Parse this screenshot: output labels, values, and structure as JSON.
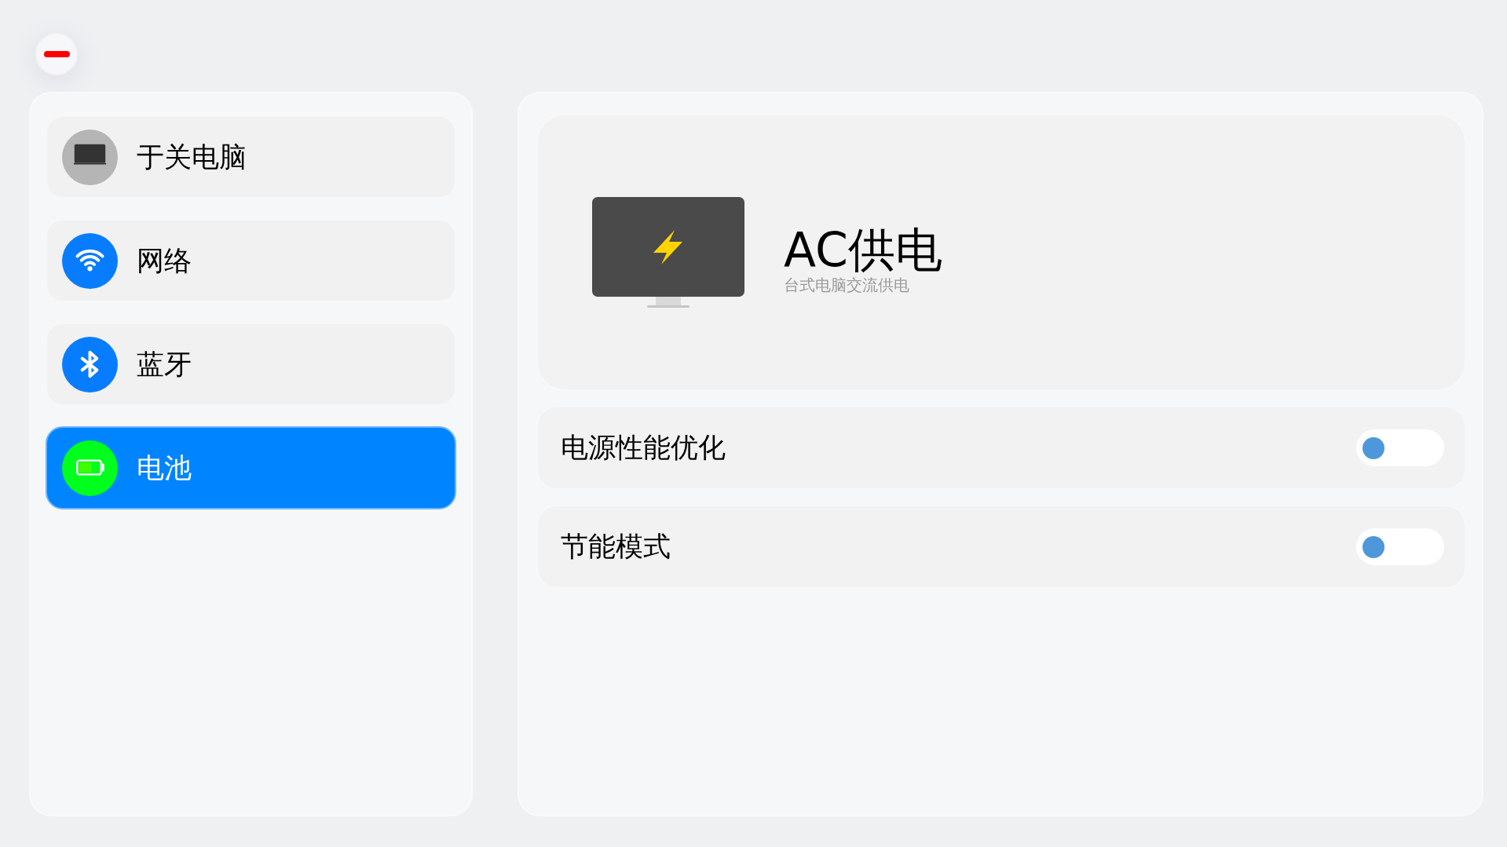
{
  "sidebar": {
    "items": [
      {
        "label": "于关电脑",
        "selected": false,
        "color": "#b5b5b5"
      },
      {
        "label": "网络",
        "selected": false,
        "color": "#087cff"
      },
      {
        "label": "蓝牙",
        "selected": false,
        "color": "#087cff"
      },
      {
        "label": "电池",
        "selected": true,
        "color": "#00ff1c"
      }
    ]
  },
  "power_source": {
    "title": "AC供电",
    "subtitle": "台式电脑交流供电"
  },
  "settings": [
    {
      "label": "电源性能优化",
      "on": false
    },
    {
      "label": "节能模式",
      "on": false
    }
  ]
}
